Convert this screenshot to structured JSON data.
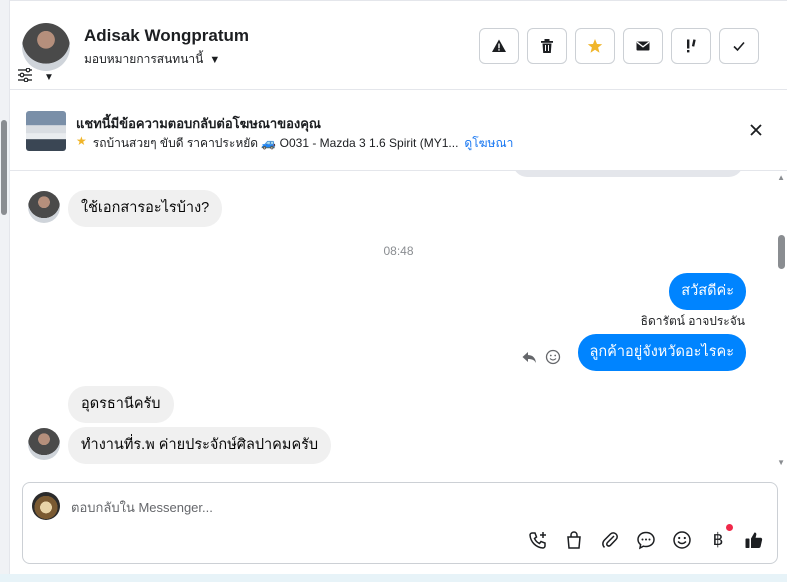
{
  "header": {
    "contact_name": "Adisak Wongpratum",
    "assign_label": "มอบหมายการสนทนานี้",
    "actions": [
      {
        "name": "report-spam-button",
        "icon": "warning-icon",
        "glyph": "⚠"
      },
      {
        "name": "delete-button",
        "icon": "trash-icon",
        "glyph": "🗑"
      },
      {
        "name": "star-button",
        "icon": "star-icon",
        "glyph": "★"
      },
      {
        "name": "mark-unread-button",
        "icon": "envelope-icon",
        "glyph": "✉"
      },
      {
        "name": "follow-up-button",
        "icon": "exclamation-icon",
        "glyph": "!!"
      },
      {
        "name": "mark-done-button",
        "icon": "check-icon",
        "glyph": "✓"
      }
    ]
  },
  "ad_banner": {
    "title": "แชทนี้มีข้อความตอบกลับต่อโฆษณาของคุณ",
    "ad_text": "รถบ้านสวยๆ ขับดี ราคาประหยัด 🚙 O031 - Mazda 3 1.6 Spirit (MY1...",
    "link": "ดูโฆษณา"
  },
  "chat": {
    "messages": [
      {
        "direction": "in",
        "text": "ใช้เอกสารอะไรบ้าง?"
      },
      {
        "direction": "out",
        "text": "สวัสดีค่ะ"
      },
      {
        "direction": "out",
        "text": "ลูกค้าอยู่จังหวัดอะไรคะ"
      },
      {
        "direction": "in",
        "text": "อุดรธานีครับ"
      },
      {
        "direction": "in",
        "text": "ทำงานที่ร.พ ค่ายประจักษ์ศิลปาคมครับ"
      }
    ],
    "timestamp": "08:48",
    "sender_name": "ธิดารัตน์ อาจประจัน"
  },
  "composer": {
    "placeholder": "ตอบกลับใน Messenger..."
  },
  "colors": {
    "outgoing_bubble": "#0084ff",
    "incoming_bubble": "#f0f0f0",
    "link": "#1877f2",
    "star": "#f0b52a",
    "notification_dot": "#f02849"
  }
}
